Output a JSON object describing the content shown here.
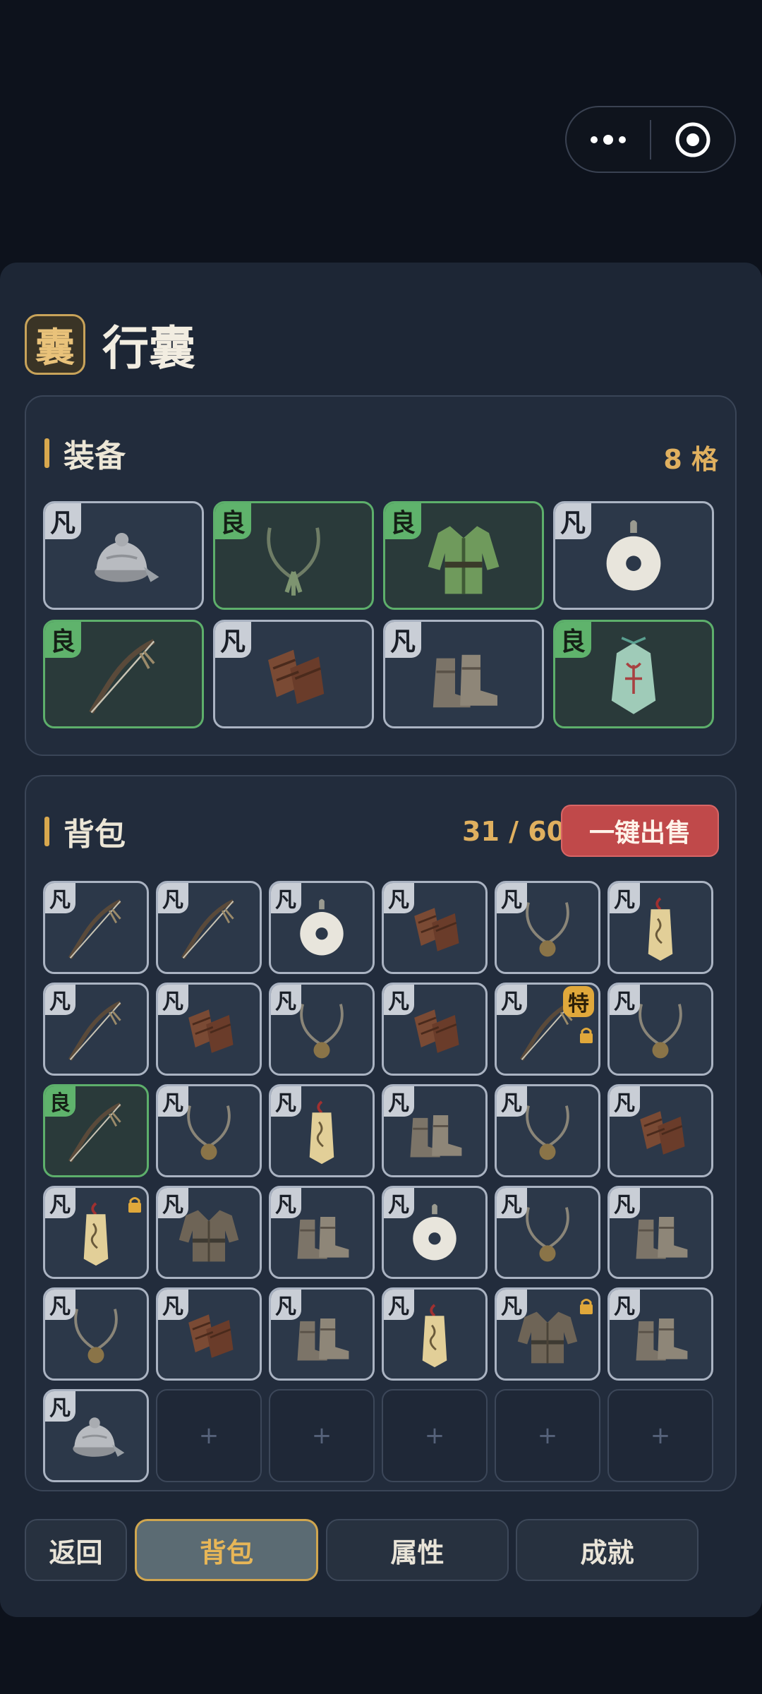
{
  "title": {
    "badge": "囊",
    "text": "行囊"
  },
  "equipment": {
    "title": "装备",
    "count": "8 格",
    "items": [
      {
        "grade": "凡",
        "quality": "common",
        "icon": "hat-icon"
      },
      {
        "grade": "良",
        "quality": "good",
        "icon": "necklace-icon"
      },
      {
        "grade": "良",
        "quality": "good",
        "icon": "robe-icon"
      },
      {
        "grade": "凡",
        "quality": "common",
        "icon": "jade-ring-icon"
      },
      {
        "grade": "良",
        "quality": "good",
        "icon": "bow-icon"
      },
      {
        "grade": "凡",
        "quality": "common",
        "icon": "bracers-icon"
      },
      {
        "grade": "凡",
        "quality": "common",
        "icon": "boots-icon"
      },
      {
        "grade": "良",
        "quality": "good",
        "icon": "talisman-icon"
      }
    ]
  },
  "bag": {
    "title": "背包",
    "count": "31 / 60",
    "sell_all_label": "一键出售",
    "empty_symbol": "+",
    "special_label": "特",
    "items": [
      {
        "grade": "凡",
        "quality": "common",
        "icon": "bow-icon"
      },
      {
        "grade": "凡",
        "quality": "common",
        "icon": "bow-icon"
      },
      {
        "grade": "凡",
        "quality": "common",
        "icon": "jade-ring-icon"
      },
      {
        "grade": "凡",
        "quality": "common",
        "icon": "bracers-icon"
      },
      {
        "grade": "凡",
        "quality": "common",
        "icon": "pendant-icon"
      },
      {
        "grade": "凡",
        "quality": "common",
        "icon": "tag-icon"
      },
      {
        "grade": "凡",
        "quality": "common",
        "icon": "bow-icon"
      },
      {
        "grade": "凡",
        "quality": "common",
        "icon": "bracers-icon"
      },
      {
        "grade": "凡",
        "quality": "common",
        "icon": "pendant-icon"
      },
      {
        "grade": "凡",
        "quality": "common",
        "icon": "bracers-icon"
      },
      {
        "grade": "凡",
        "quality": "common",
        "icon": "bow-icon",
        "special": true,
        "locked": true
      },
      {
        "grade": "凡",
        "quality": "common",
        "icon": "pendant-icon"
      },
      {
        "grade": "良",
        "quality": "good",
        "icon": "bow-icon"
      },
      {
        "grade": "凡",
        "quality": "common",
        "icon": "pendant-icon"
      },
      {
        "grade": "凡",
        "quality": "common",
        "icon": "tag-icon"
      },
      {
        "grade": "凡",
        "quality": "common",
        "icon": "boots-icon"
      },
      {
        "grade": "凡",
        "quality": "common",
        "icon": "pendant-icon"
      },
      {
        "grade": "凡",
        "quality": "common",
        "icon": "bracers-icon"
      },
      {
        "grade": "凡",
        "quality": "common",
        "icon": "tag-icon",
        "locked": true
      },
      {
        "grade": "凡",
        "quality": "common",
        "icon": "tunic-icon"
      },
      {
        "grade": "凡",
        "quality": "common",
        "icon": "boots-icon"
      },
      {
        "grade": "凡",
        "quality": "common",
        "icon": "jade-ring-icon"
      },
      {
        "grade": "凡",
        "quality": "common",
        "icon": "pendant-icon"
      },
      {
        "grade": "凡",
        "quality": "common",
        "icon": "boots-icon"
      },
      {
        "grade": "凡",
        "quality": "common",
        "icon": "pendant-icon"
      },
      {
        "grade": "凡",
        "quality": "common",
        "icon": "bracers-icon"
      },
      {
        "grade": "凡",
        "quality": "common",
        "icon": "boots-icon"
      },
      {
        "grade": "凡",
        "quality": "common",
        "icon": "tag-icon"
      },
      {
        "grade": "凡",
        "quality": "common",
        "icon": "tunic-icon",
        "locked": true
      },
      {
        "grade": "凡",
        "quality": "common",
        "icon": "boots-icon"
      },
      {
        "grade": "凡",
        "quality": "common",
        "icon": "hat-icon"
      },
      {
        "empty": true
      },
      {
        "empty": true
      },
      {
        "empty": true
      },
      {
        "empty": true
      },
      {
        "empty": true
      }
    ]
  },
  "nav": {
    "back": "返回",
    "bag": "背包",
    "attributes": "属性",
    "achievements": "成就"
  },
  "colors": {
    "common": "#aab3c2",
    "good": "#5daf6b",
    "accent": "#d8a84e",
    "sell": "#c0494a"
  }
}
